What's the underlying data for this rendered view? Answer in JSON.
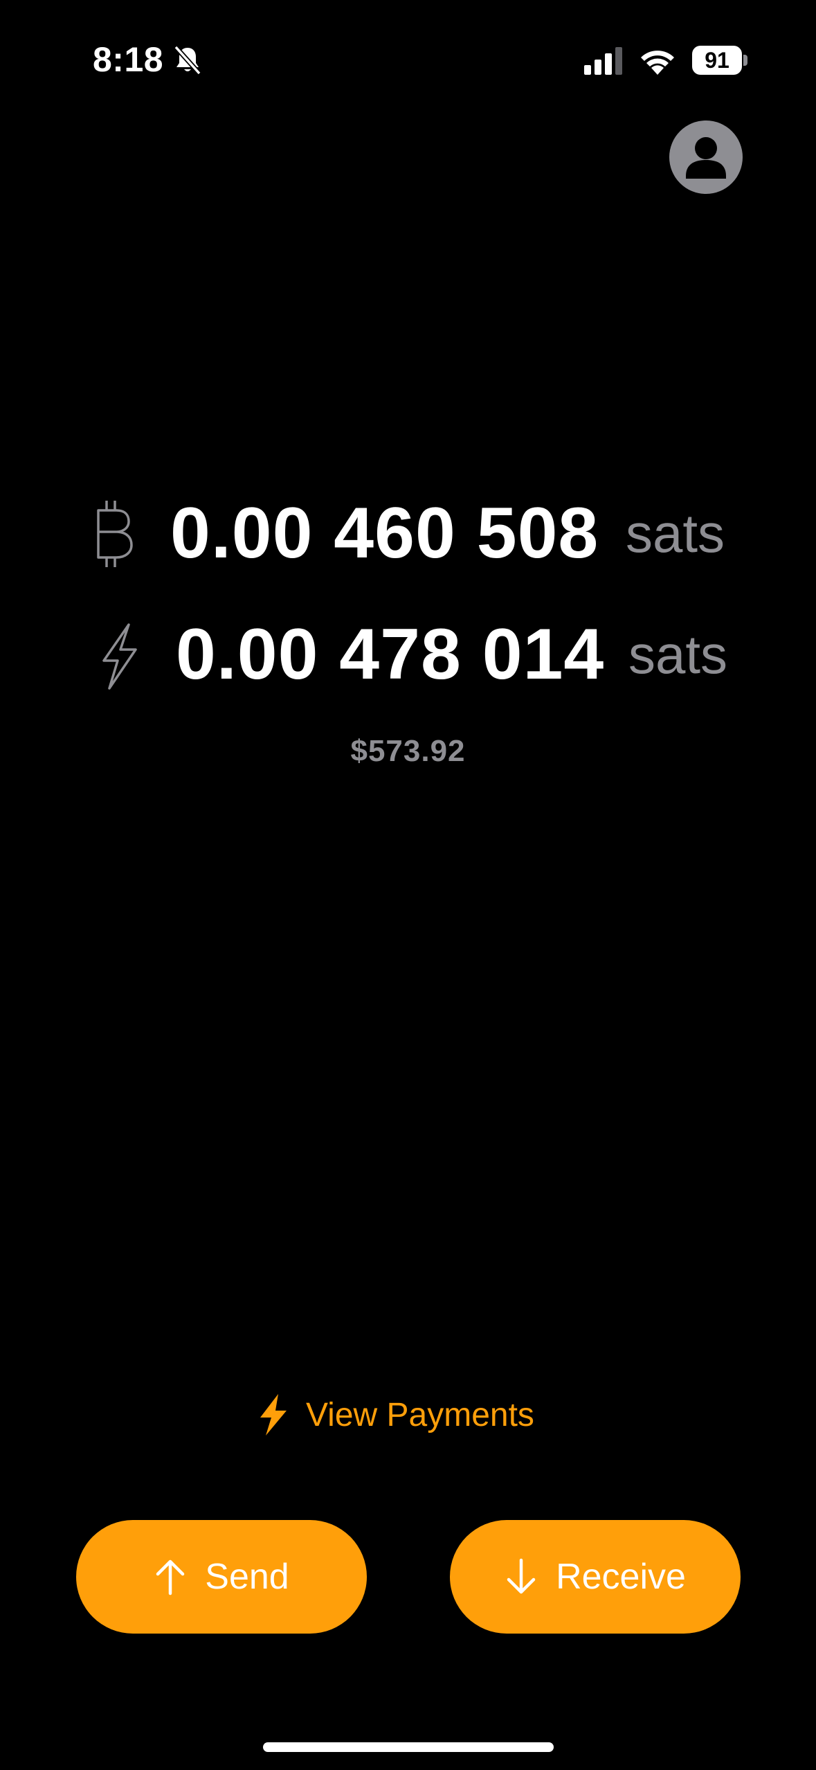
{
  "status_bar": {
    "time": "8:18",
    "battery": "91"
  },
  "balances": {
    "onchain": {
      "icon": "bitcoin-icon",
      "amount": "0.00 460 508",
      "unit": "sats"
    },
    "lightning": {
      "icon": "lightning-icon",
      "amount": "0.00 478 014",
      "unit": "sats"
    },
    "fiat": "$573.92"
  },
  "view_payments": {
    "label": "View Payments",
    "icon": "lightning-bolt-icon"
  },
  "actions": {
    "send_label": "Send",
    "receive_label": "Receive"
  },
  "colors": {
    "accent": "#ff9f0a",
    "background": "#000000",
    "muted": "#8e8e93"
  }
}
